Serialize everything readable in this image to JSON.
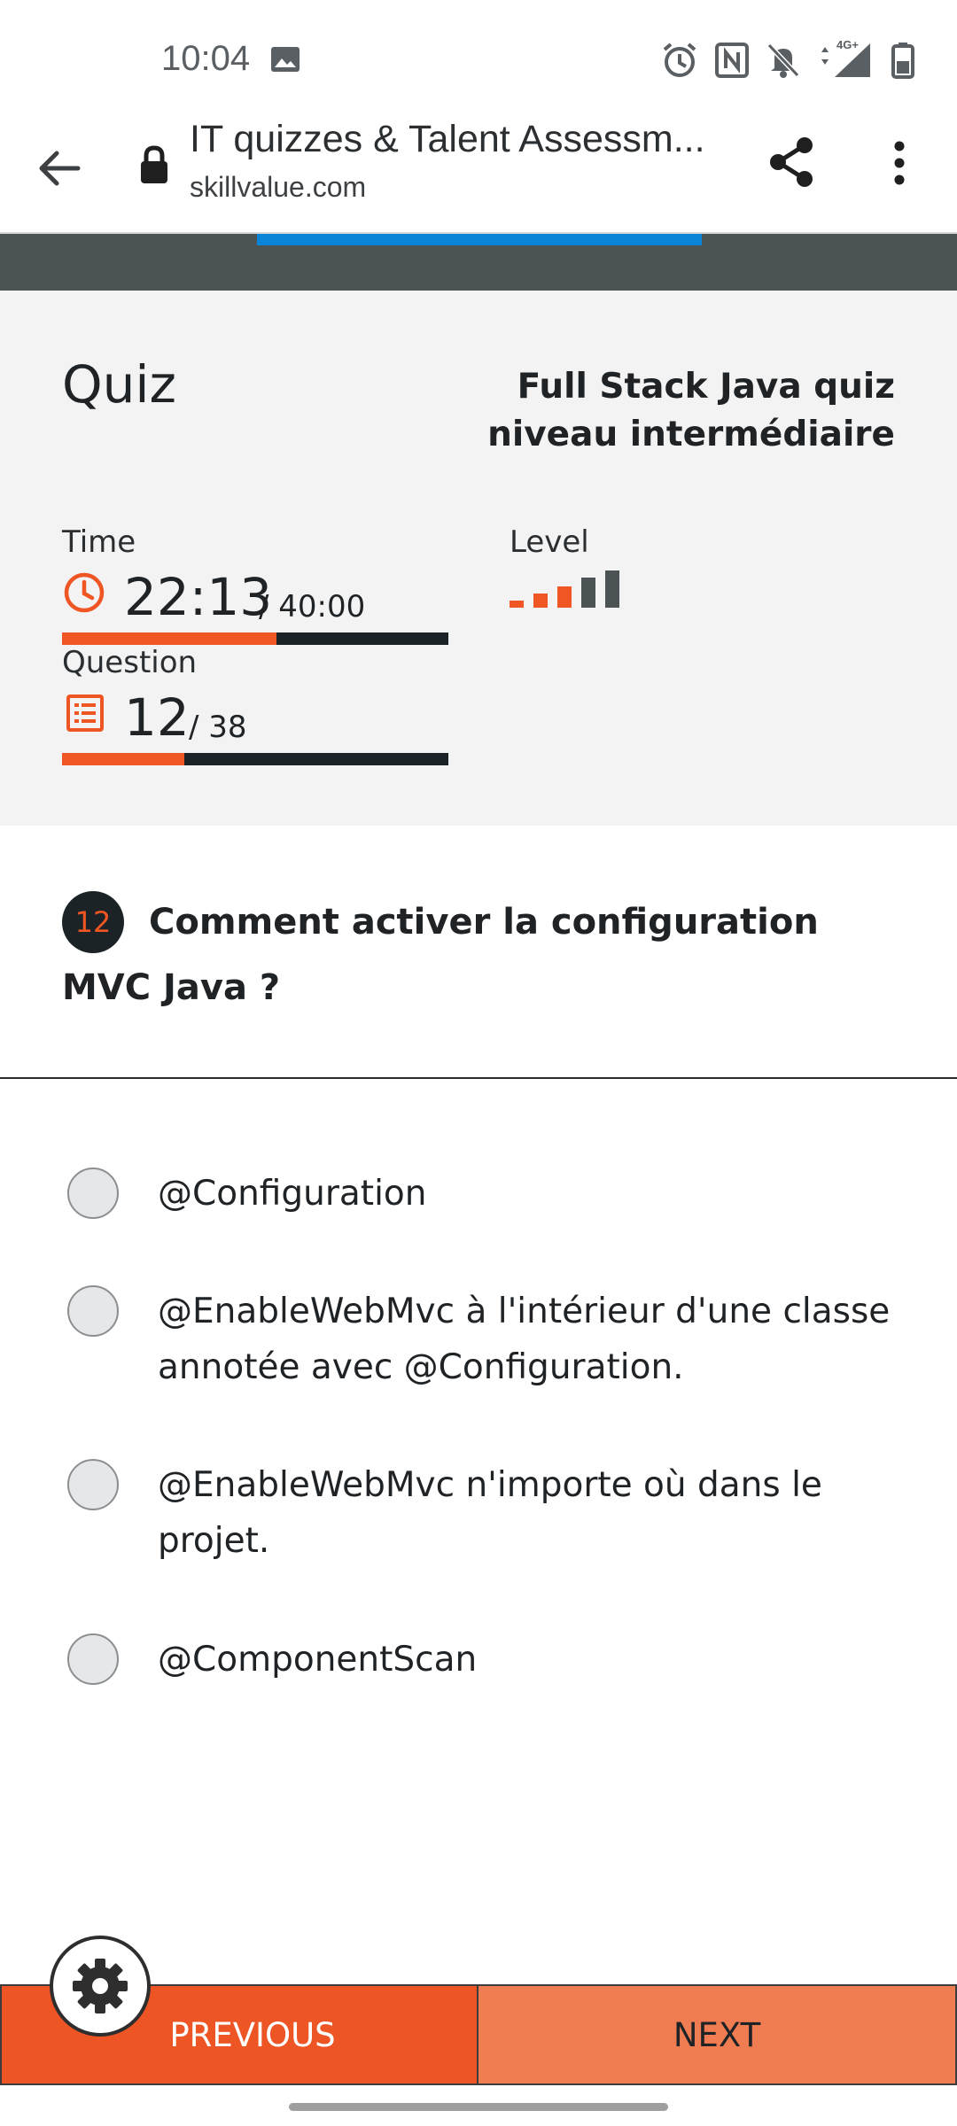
{
  "status_bar": {
    "time": "10:04",
    "icons": [
      "gallery-icon",
      "alarm-icon",
      "nfc-icon",
      "mute-icon",
      "4g-signal-icon",
      "battery-icon"
    ],
    "network_label": "4G+"
  },
  "browser": {
    "page_title": "IT quizzes & Talent Assessm...",
    "url": "skillvalue.com"
  },
  "quiz": {
    "heading": "Quiz",
    "name": "Full Stack Java quiz niveau intermédiaire",
    "time_label": "Time",
    "time_value": "22:13",
    "time_total": "/ 40:00",
    "time_progress": 0.556,
    "level_label": "Level",
    "level_value": 3,
    "level_max": 5,
    "question_label": "Question",
    "question_value": "12",
    "question_total": "/ 38",
    "question_progress": 0.316
  },
  "question": {
    "number": "12",
    "text": "Comment activer la configuration MVC Java ?"
  },
  "answers": [
    "@Configuration",
    "@EnableWebMvc à l'intérieur d'une classe annotée avec @Configuration.",
    "@EnableWebMvc n'importe où dans le projet.",
    "@ComponentScan"
  ],
  "buttons": {
    "previous": "PREVIOUS",
    "next": "NEXT"
  },
  "colors": {
    "accent": "#ef5623",
    "next_button": "#f07c52",
    "dark": "#1c2326",
    "browser_progress": "#0a84d6",
    "level_inactive": "#4b5355"
  }
}
